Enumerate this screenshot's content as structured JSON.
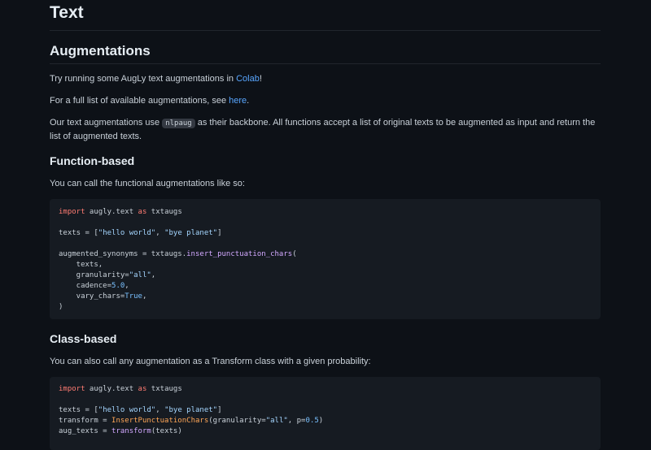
{
  "page": {
    "title": "Text",
    "section_title": "Augmentations",
    "intro": {
      "prefix": "Try running some AugLy text augmentations in ",
      "link": "Colab",
      "suffix": "!"
    },
    "full_list": {
      "prefix": "For a full list of available augmentations, see ",
      "link": "here",
      "suffix": "."
    },
    "backbone": {
      "prefix": "Our text augmentations use ",
      "code": "nlpaug",
      "suffix": " as their backbone. All functions accept a list of original texts to be augmented as input and return the list of augmented texts."
    },
    "function_based": {
      "heading": "Function-based",
      "description": "You can call the functional augmentations like so:",
      "code": {
        "l1_kw": "import",
        "l1_mid": " augly.text ",
        "l1_kw2": "as",
        "l1_end": " txtaugs",
        "l3_a": "texts = [",
        "l3_s1": "\"hello world\"",
        "l3_b": ", ",
        "l3_s2": "\"bye planet\"",
        "l3_c": "]",
        "l5_a": "augmented_synonyms = txtaugs.",
        "l5_fn": "insert_punctuation_chars",
        "l5_b": "(",
        "l6": "    texts,",
        "l7_a": "    granularity=",
        "l7_s": "\"all\"",
        "l7_b": ",",
        "l8_a": "    cadence=",
        "l8_n": "5.0",
        "l8_b": ",",
        "l9_a": "    vary_chars=",
        "l9_n": "True",
        "l9_b": ",",
        "l10": ")"
      }
    },
    "class_based": {
      "heading": "Class-based",
      "description": "You can also call any augmentation as a Transform class with a given probability:",
      "code": {
        "l1_kw": "import",
        "l1_mid": " augly.text ",
        "l1_kw2": "as",
        "l1_end": " txtaugs",
        "l3_a": "texts = [",
        "l3_s1": "\"hello world\"",
        "l3_b": ", ",
        "l3_s2": "\"bye planet\"",
        "l3_c": "]",
        "l4_a": "transform = ",
        "l4_cls": "InsertPunctuationChars",
        "l4_b": "(granularity=",
        "l4_s": "\"all\"",
        "l4_c": ", p=",
        "l4_n": "0.5",
        "l4_d": ")",
        "l5_a": "aug_texts = ",
        "l5_fn": "transform",
        "l5_b": "(texts)"
      }
    },
    "colors": {
      "background": "#0d1117",
      "text": "#c9d1d9",
      "link": "#58a6ff",
      "code_background": "#161b22"
    }
  }
}
